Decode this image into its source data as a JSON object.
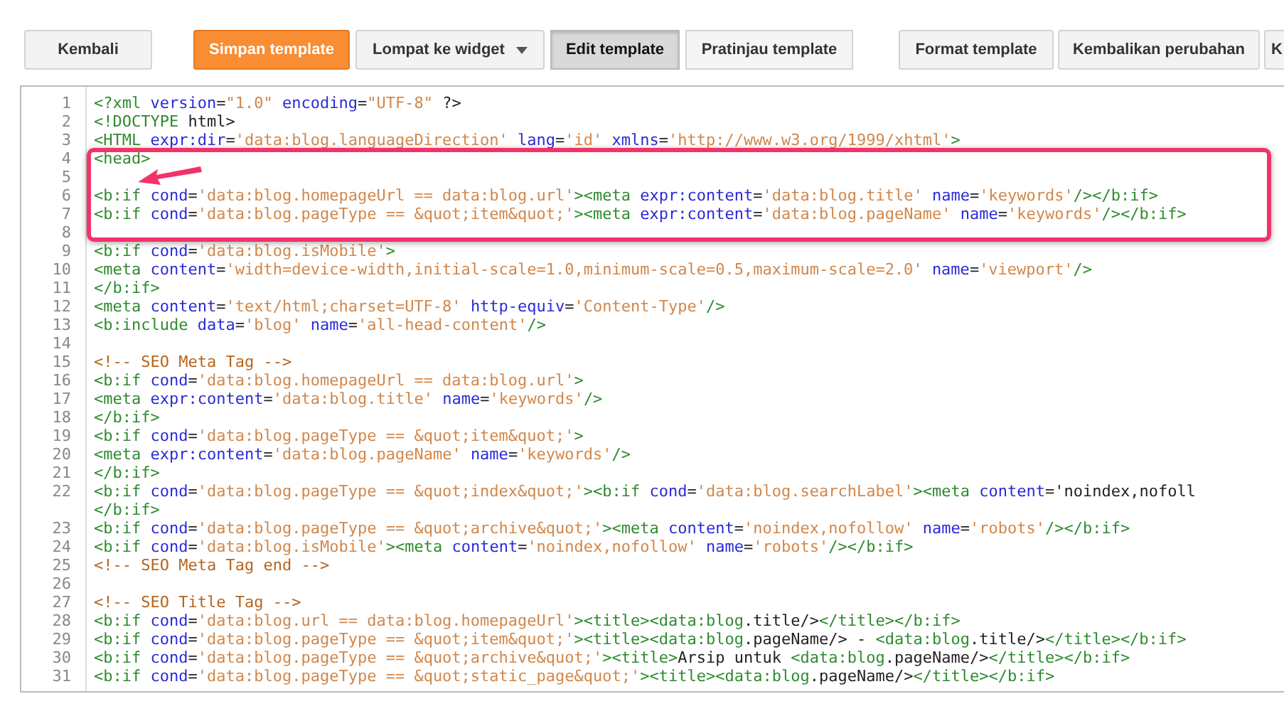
{
  "toolbar": [
    {
      "label": "Kembali",
      "kind": "plain"
    },
    {
      "label": "Simpan template",
      "kind": "primary"
    },
    {
      "label": "Lompat ke widget",
      "kind": "dropdown"
    },
    {
      "label": "Edit template",
      "kind": "segment",
      "selected": true
    },
    {
      "label": "Pratinjau template",
      "kind": "segment",
      "selected": false
    },
    {
      "label": "Format template",
      "kind": "plain"
    },
    {
      "label": "Kembalikan perubahan",
      "kind": "plain"
    },
    {
      "label": "K",
      "kind": "plain"
    }
  ],
  "editor": {
    "lines": [
      {
        "number": "1",
        "code": "<?xml version=\"1.0\" encoding=\"UTF-8\" ?>"
      },
      {
        "number": "2",
        "code": "<!DOCTYPE html>"
      },
      {
        "number": "3",
        "code": "<HTML expr:dir='data:blog.languageDirection' lang='id' xmlns='http://www.w3.org/1999/xhtml'>"
      },
      {
        "number": "4",
        "code": "<head>"
      },
      {
        "number": "5"
      },
      {
        "number": "6",
        "code": "<b:if cond='data:blog.homepageUrl == data:blog.url'><meta expr:content='data:blog.title' name='keywords'/></b:if>"
      },
      {
        "number": "7",
        "code": "<b:if cond='data:blog.pageType == &quot;item&quot;'><meta expr:content='data:blog.pageName' name='keywords'/></b:if>"
      },
      {
        "number": "8"
      },
      {
        "number": "9",
        "code": "<b:if cond='data:blog.isMobile'>"
      },
      {
        "number": "10",
        "code": "<meta content='width=device-width,initial-scale=1.0,minimum-scale=0.5,maximum-scale=2.0' name='viewport'/>"
      },
      {
        "number": "11",
        "code": "</b:if>"
      },
      {
        "number": "12",
        "code": "<meta content='text/html;charset=UTF-8' http-equiv='Content-Type'/>"
      },
      {
        "number": "13",
        "code": "<b:include data='blog' name='all-head-content'/>"
      },
      {
        "number": "14"
      },
      {
        "number": "15",
        "code": "<!-- SEO Meta Tag -->"
      },
      {
        "number": "16",
        "code": "<b:if cond='data:blog.homepageUrl == data:blog.url'>"
      },
      {
        "number": "17",
        "code": "<meta expr:content='data:blog.title' name='keywords'/>"
      },
      {
        "number": "18",
        "code": "</b:if>"
      },
      {
        "number": "19",
        "code": "<b:if cond='data:blog.pageType == &quot;item&quot;'>"
      },
      {
        "number": "20",
        "code": "<meta expr:content='data:blog.pageName' name='keywords'/>"
      },
      {
        "number": "21",
        "code": "</b:if>"
      },
      {
        "number": "22",
        "code": "<b:if cond='data:blog.pageType == &quot;index&quot;'><b:if cond='data:blog.searchLabel'><meta content='noindex,nofoll"
      },
      {
        "code": "</b:if>"
      },
      {
        "number": "23",
        "code": "<b:if cond='data:blog.pageType == &quot;archive&quot;'><meta content='noindex,nofollow' name='robots'/></b:if>"
      },
      {
        "number": "24",
        "code": "<b:if cond='data:blog.isMobile'><meta content='noindex,nofollow' name='robots'/></b:if>"
      },
      {
        "number": "25",
        "code": "<!-- SEO Meta Tag end -->"
      },
      {
        "number": "26"
      },
      {
        "number": "27",
        "code": "<!-- SEO Title Tag -->"
      },
      {
        "number": "28",
        "code": "<b:if cond='data:blog.url == data:blog.homepageUrl'><title><data:blog.title/></title></b:if>"
      },
      {
        "number": "29",
        "code": "<b:if cond='data:blog.pageType == &quot;item&quot;'><title><data:blog.pageName/> - <data:blog.title/></title></b:if>"
      },
      {
        "number": "30",
        "code": "<b:if cond='data:blog.pageType == &quot;archive&quot;'><title>Arsip untuk <data:blog.pageName/></title></b:if>"
      },
      {
        "number": "31",
        "code": "<b:if cond='data:blog.pageType == &quot;static_page&quot;'><title><data:blog.pageName/></title></b:if>"
      }
    ]
  }
}
